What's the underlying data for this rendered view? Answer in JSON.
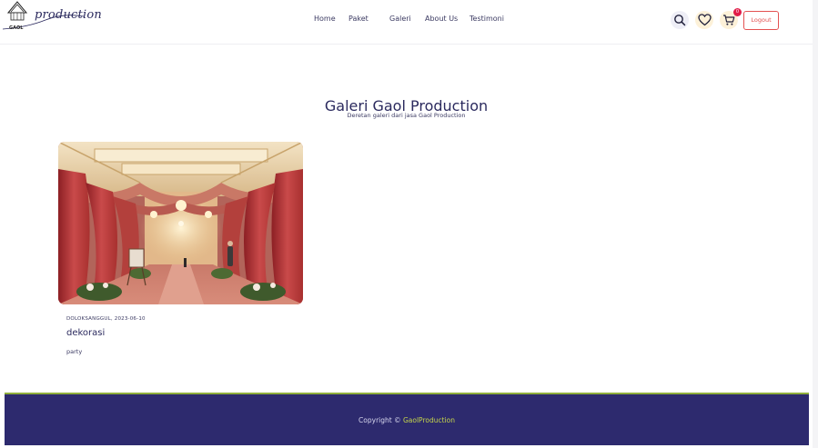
{
  "header": {
    "logo": {
      "script_text": "production",
      "small_text": "GAOL"
    },
    "nav": [
      {
        "label": "Home"
      },
      {
        "label": "Paket"
      },
      {
        "label": "Galeri"
      },
      {
        "label": "About Us"
      },
      {
        "label": "Testimoni"
      }
    ],
    "icons": {
      "search": "search-icon",
      "wishlist": "heart-icon",
      "cart": "cart-icon"
    },
    "cart_count": "0",
    "logout_label": "Logout"
  },
  "main": {
    "title": "Galeri Gaol Production",
    "subtitle": "Deretan galeri dari jasa Gaol Production",
    "gallery": [
      {
        "location_date": "DOLOKSANGGUL, 2023-06-10",
        "title": "dekorasi",
        "category": "party"
      }
    ]
  },
  "footer": {
    "copyright_prefix": "Copyright ©",
    "brand_link": "GaolProduction"
  },
  "colors": {
    "primary": "#2d2a6e",
    "accent": "#c6d64a",
    "logout": "#e35151",
    "badge": "#e11d48"
  }
}
